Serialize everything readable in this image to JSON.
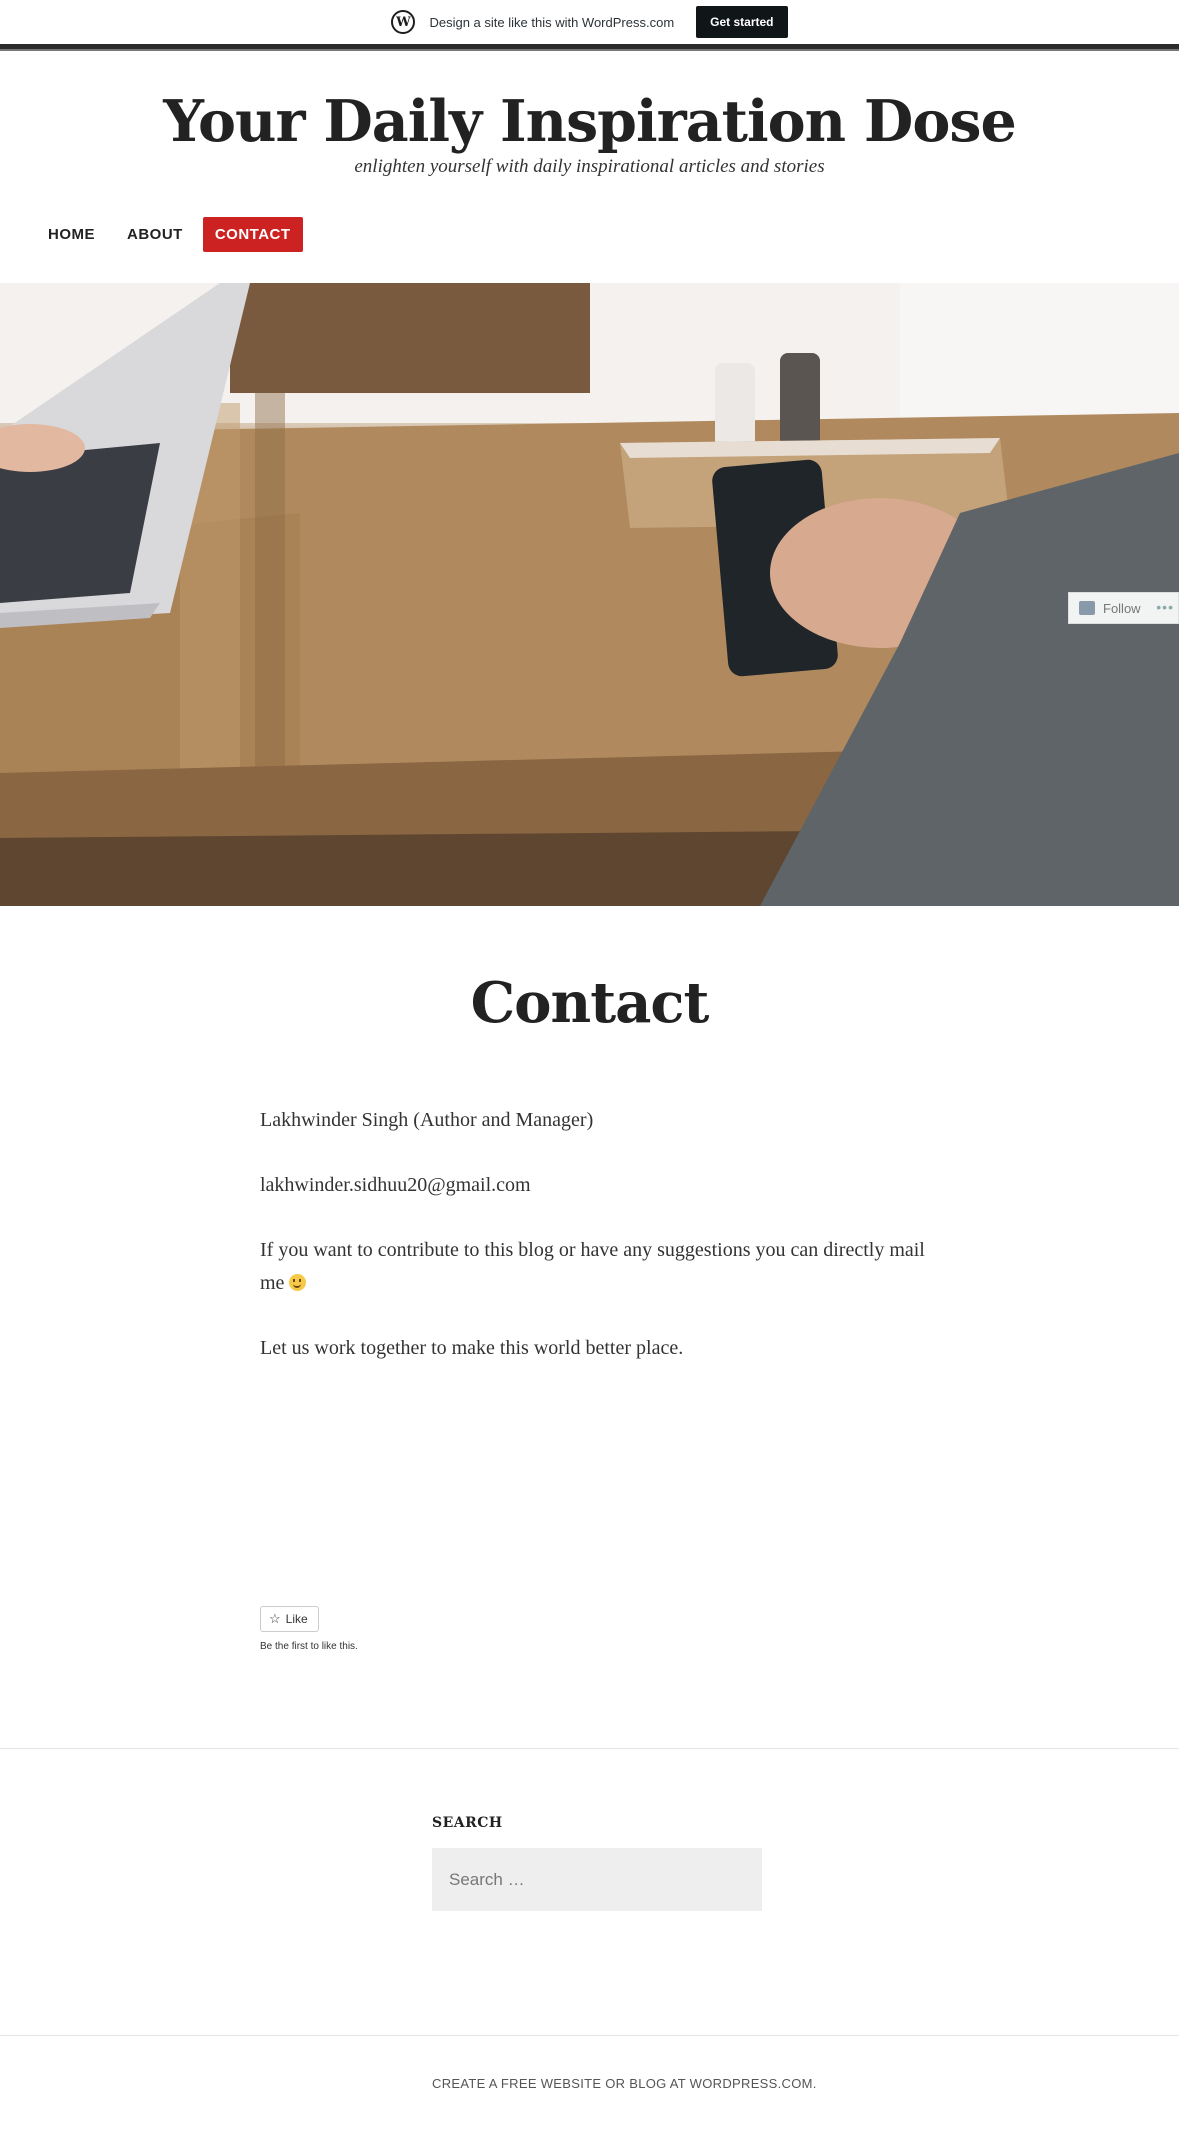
{
  "banner": {
    "logo_glyph": "W",
    "text": "Design a site like this with WordPress.com",
    "cta_label": "Get started"
  },
  "header": {
    "site_title": "Your Daily Inspiration Dose",
    "tagline": "enlighten yourself with daily inspirational articles and stories"
  },
  "nav": {
    "items": [
      {
        "label": "HOME"
      },
      {
        "label": "ABOUT"
      },
      {
        "label": "CONTACT",
        "active": true
      }
    ],
    "active_color": "#cc2222"
  },
  "follow": {
    "label": "Follow",
    "more_label": "•••"
  },
  "page": {
    "title": "Contact",
    "paragraphs": [
      "Lakhwinder Singh (Author and Manager)",
      "lakhwinder.sidhuu20@gmail.com",
      "If you want to contribute to this blog or have any suggestions you can directly mail me",
      "Let us work together to make this world better place."
    ]
  },
  "like": {
    "button_label": "Like",
    "note": "Be the first to like this."
  },
  "search_widget": {
    "title": "SEARCH",
    "placeholder": "Search …"
  },
  "footer": {
    "site_info": "CREATE A FREE WEBSITE OR BLOG AT WORDPRESS.COM."
  }
}
